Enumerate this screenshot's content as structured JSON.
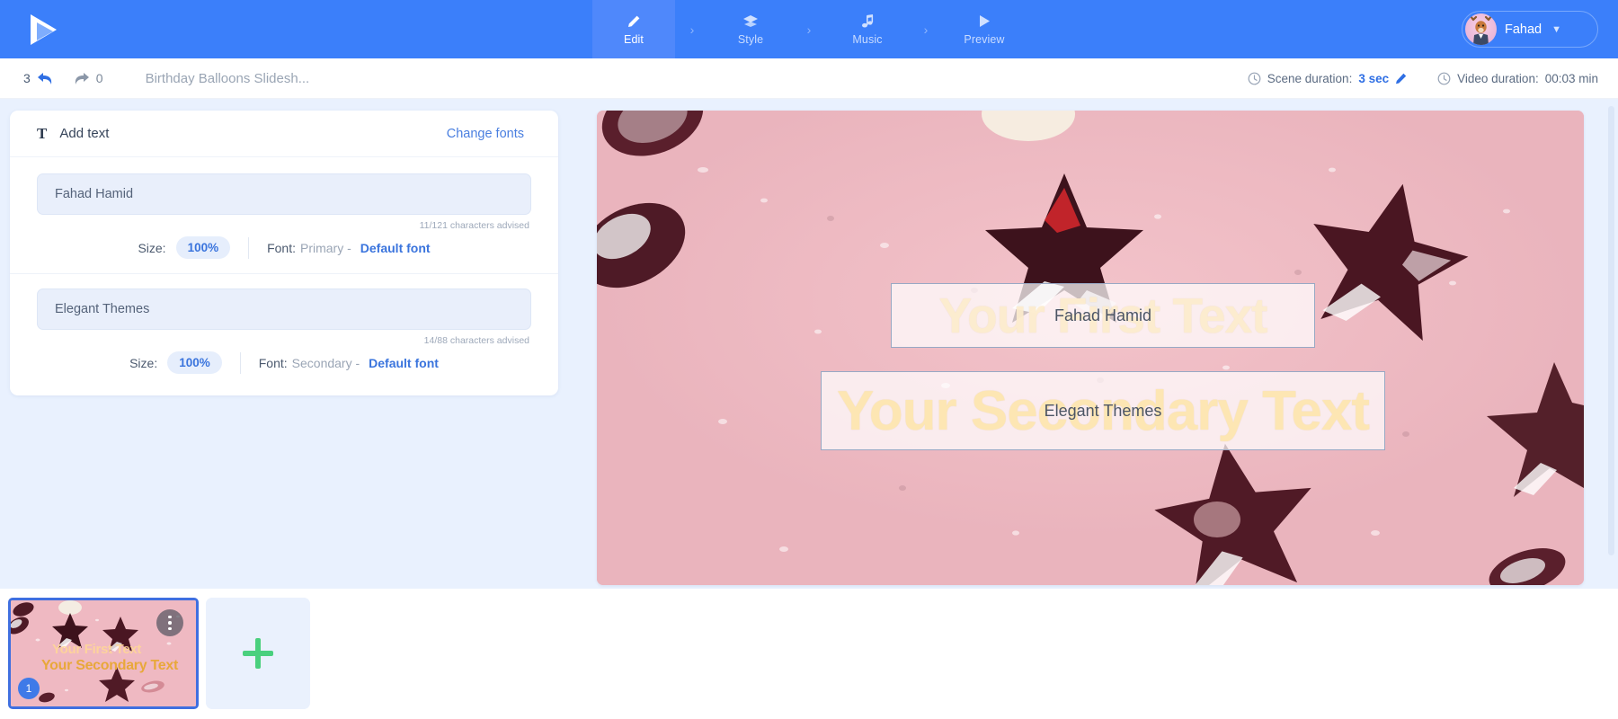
{
  "header": {
    "logo_icon": "play-triangle-logo",
    "tabs": [
      {
        "label": "Edit",
        "icon": "pencil-icon",
        "active": true
      },
      {
        "label": "Style",
        "icon": "layers-icon",
        "active": false
      },
      {
        "label": "Music",
        "icon": "music-note-icon",
        "active": false
      },
      {
        "label": "Preview",
        "icon": "play-icon",
        "active": false
      }
    ],
    "separator": "›",
    "user": {
      "name": "Fahad",
      "avatar_icon": "deer-avatar",
      "chevron_icon": "chevron-down-icon"
    },
    "accent_color": "#3b7ffa",
    "active_tab_color": "#4f88fb"
  },
  "subbar": {
    "undo_count": "3",
    "undo_icon": "undo-arrow-icon",
    "redo_count": "0",
    "redo_icon": "redo-arrow-icon",
    "project_title": "Birthday Balloons Slidesh...",
    "scene_duration_label": "Scene duration:",
    "scene_duration_value": "3 sec",
    "scene_duration_edit_icon": "pencil-edit-icon",
    "video_duration_label": "Video duration:",
    "video_duration_value": "00:03 min",
    "clock_icon": "clock-icon"
  },
  "panel": {
    "icon": "text-T-icon",
    "title": "Add text",
    "change_fonts": "Change fonts",
    "blocks": [
      {
        "value": "Fahad Hamid",
        "char_hint": "11/121 characters advised",
        "size_label": "Size:",
        "size_value": "100%",
        "font_label": "Font:",
        "font_kind": "Primary -",
        "font_value": "Default font"
      },
      {
        "value": "Elegant Themes",
        "char_hint": "14/88 characters advised",
        "size_label": "Size:",
        "size_value": "100%",
        "font_label": "Font:",
        "font_kind": "Secondary -",
        "font_value": "Default font"
      }
    ]
  },
  "canvas": {
    "background_color": "#efb9c2",
    "overlays": [
      {
        "placeholder": "Your First Text",
        "value": "Fahad Hamid"
      },
      {
        "placeholder": "Your Secondary Text",
        "value": "Elegant Themes"
      }
    ]
  },
  "filmstrip": {
    "slide_number": "1",
    "thumb_text_primary": "Your First Text",
    "thumb_text_secondary": "Your Secondary Text",
    "menu_icon": "three-dots-icon",
    "add_icon": "plus-icon"
  }
}
